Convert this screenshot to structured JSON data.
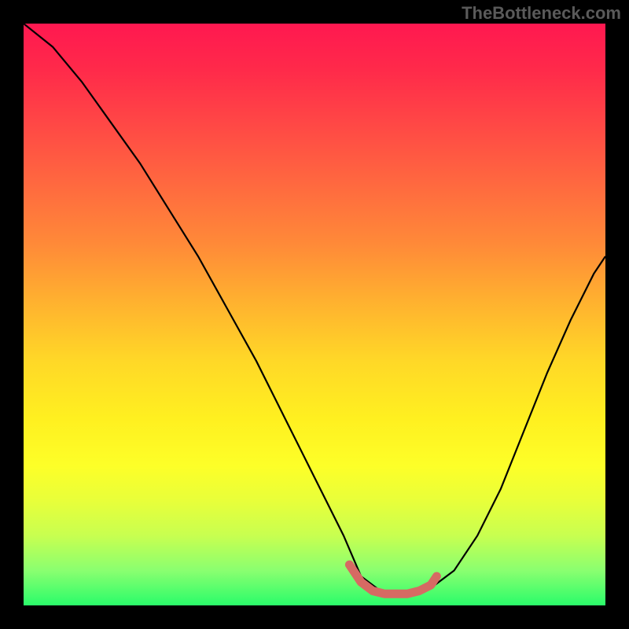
{
  "watermark": "TheBottleneck.com",
  "chart_data": {
    "type": "line",
    "title": "",
    "xlabel": "",
    "ylabel": "",
    "xlim": [
      0,
      100
    ],
    "ylim": [
      0,
      100
    ],
    "grid": false,
    "legend": false,
    "description": "V-shaped bottleneck curve on a vertical heat gradient (red=high bottleneck at top, green=low bottleneck at bottom). The black curve descends from upper-left to a flat minimum around x 58-70 then rises toward upper-right. A short salmon segment highlights the optimal flat region.",
    "series": [
      {
        "name": "bottleneck-curve",
        "color": "#000000",
        "x": [
          0,
          5,
          10,
          15,
          20,
          25,
          30,
          35,
          40,
          45,
          50,
          55,
          58,
          62,
          66,
          70,
          74,
          78,
          82,
          86,
          90,
          94,
          98,
          100
        ],
        "y": [
          100,
          96,
          90,
          83,
          76,
          68,
          60,
          51,
          42,
          32,
          22,
          12,
          5,
          2,
          2,
          3,
          6,
          12,
          20,
          30,
          40,
          49,
          57,
          60
        ]
      },
      {
        "name": "optimal-range-highlight",
        "color": "#d66a63",
        "x": [
          56,
          58,
          60,
          62,
          64,
          66,
          68,
          70,
          71
        ],
        "y": [
          7,
          4,
          2.5,
          2,
          2,
          2,
          2.5,
          3.5,
          5
        ]
      }
    ],
    "gradient_stops": [
      {
        "pos": 0,
        "color": "#ff1850"
      },
      {
        "pos": 50,
        "color": "#ffd020"
      },
      {
        "pos": 100,
        "color": "#2afc6a"
      }
    ]
  }
}
